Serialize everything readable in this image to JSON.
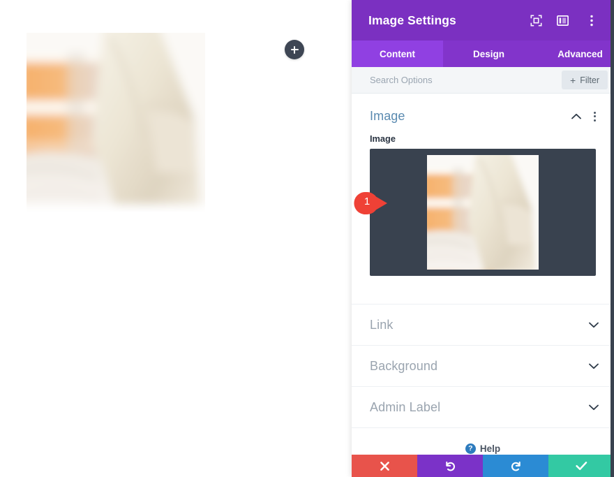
{
  "canvas": {
    "image_alt": "blurred cream upholstered chair against orange wooden shelving",
    "add_module_label": "+"
  },
  "panel": {
    "header": {
      "title": "Image Settings",
      "icons": [
        {
          "name": "fullscreen-icon",
          "label": "Fullscreen Mode"
        },
        {
          "name": "panel-layout-icon",
          "label": "Panel Layout"
        },
        {
          "name": "kebab-menu-icon",
          "label": "More Options"
        }
      ]
    },
    "tabs": [
      {
        "label": "Content",
        "active": true
      },
      {
        "label": "Design",
        "active": false
      },
      {
        "label": "Advanced",
        "active": false
      }
    ],
    "search": {
      "value": "",
      "placeholder": "Search Options"
    },
    "filter": {
      "plus": "+",
      "label": "Filter"
    },
    "open_section": {
      "title": "Image",
      "field_label": "Image",
      "expanded": true
    },
    "accordion": [
      {
        "title": "Link",
        "expanded": false
      },
      {
        "title": "Background",
        "expanded": false
      },
      {
        "title": "Admin Label",
        "expanded": false
      }
    ],
    "help": {
      "icon_glyph": "?",
      "label": "Help"
    },
    "footer_buttons": [
      {
        "name": "cancel-button",
        "icon": "close-icon",
        "color": "#e8534b"
      },
      {
        "name": "undo-button",
        "icon": "undo-icon",
        "color": "#7b32c8"
      },
      {
        "name": "redo-button",
        "icon": "redo-icon",
        "color": "#2b8bd4"
      },
      {
        "name": "save-button",
        "icon": "check-icon",
        "color": "#33c9a3"
      }
    ]
  },
  "annotation": {
    "marker_number": "1",
    "marker_color": "#ef4136"
  },
  "colors": {
    "header_purple": "#7b30c1",
    "tabbar_purple": "#8234cb",
    "active_tab_purple": "#9040e2",
    "section_title_blue": "#5a8ab0",
    "upload_dark": "#39424f",
    "collapsed_gray": "#9aa4af"
  }
}
